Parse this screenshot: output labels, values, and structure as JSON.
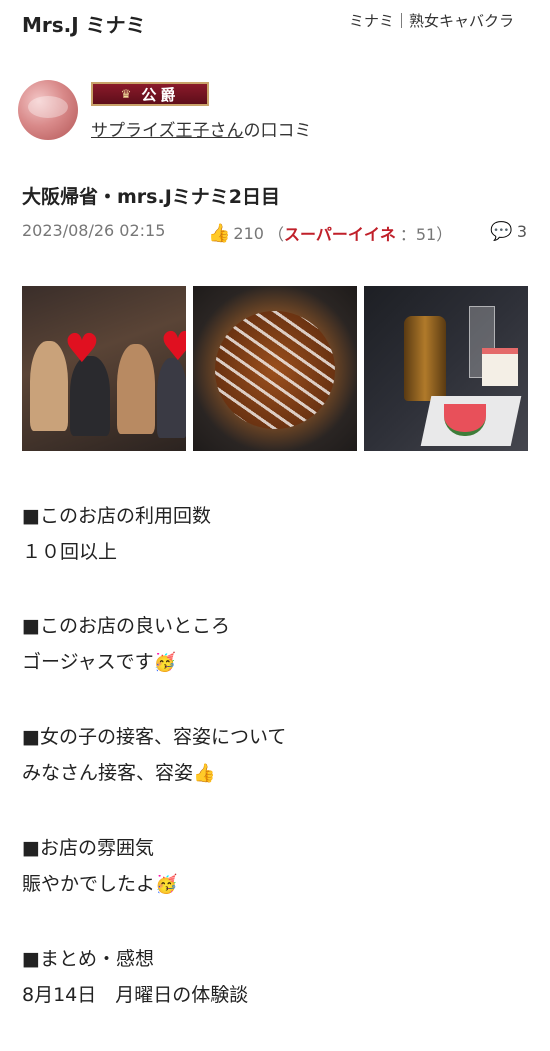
{
  "header": {
    "store_name": "Mrs.J ミナミ",
    "category": "ミナミ｜熟女キャバクラ"
  },
  "reviewer": {
    "rank_label": "公爵",
    "name": "サプライズ王子さん",
    "suffix": "の口コミ"
  },
  "post": {
    "title": "大阪帰省・mrs.Jミナミ2日目",
    "date": "2023/08/26 02:15",
    "like_count": "210",
    "super_open": "（",
    "super_label": "スーパーイイネ",
    "super_count": "：51）",
    "comment_count": "3"
  },
  "photos": [
    "photo-1",
    "photo-2",
    "photo-3"
  ],
  "sections": [
    {
      "heading": "■このお店の利用回数",
      "body": "１０回以上",
      "emoji": ""
    },
    {
      "heading": "■このお店の良いところ",
      "body": "ゴージャスです",
      "emoji": "🥳"
    },
    {
      "heading": "■女の子の接客、容姿について",
      "body": "みなさん接客、容姿",
      "emoji": "👍"
    },
    {
      "heading": "■お店の雰囲気",
      "body": "賑やかでしたよ",
      "emoji": "🥳"
    },
    {
      "heading": "■まとめ・感想",
      "body": "8月14日　月曜日の体験談",
      "emoji": ""
    }
  ],
  "icons": {
    "thumb": "thumbs-up-icon",
    "comment": "comment-bubble-icon",
    "crown": "crown-icon"
  },
  "colors": {
    "super_like": "#c0202a",
    "like_icon": "#d33a2b",
    "comment_icon": "#2f79c4",
    "rank_badge": "#7a1422"
  }
}
